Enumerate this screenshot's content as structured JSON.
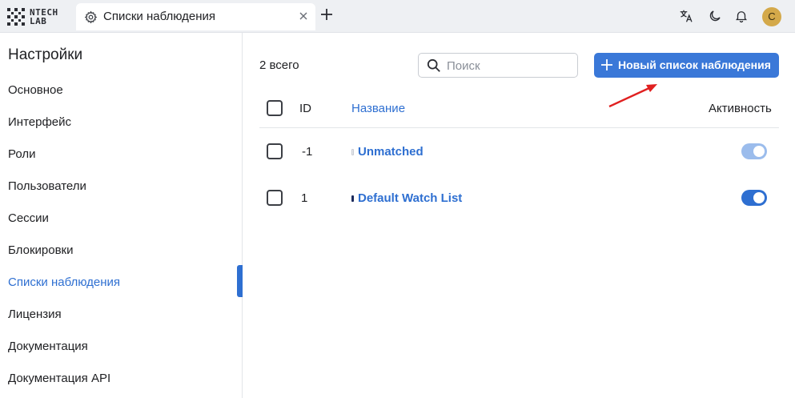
{
  "topbar": {
    "logo_line1": "NTECH",
    "logo_line2": "LAB",
    "tab_label": "Списки наблюдения",
    "tab_icon": "gear-icon",
    "icons": [
      "translate-icon",
      "moon-icon",
      "bell-icon"
    ],
    "avatar_letter": "C",
    "avatar_color": "#d4a94a"
  },
  "sidebar": {
    "title": "Настройки",
    "items": [
      {
        "label": "Основное"
      },
      {
        "label": "Интерфейс"
      },
      {
        "label": "Роли"
      },
      {
        "label": "Пользователи"
      },
      {
        "label": "Сессии"
      },
      {
        "label": "Блокировки"
      },
      {
        "label": "Списки наблюдения"
      },
      {
        "label": "Лицензия"
      },
      {
        "label": "Документация"
      },
      {
        "label": "Документация API"
      }
    ],
    "active_item": "Списки наблюдения",
    "accent_color": "#2e6fd1"
  },
  "main": {
    "count_label": "2 всего",
    "search": {
      "placeholder": "Поиск",
      "value": ""
    },
    "new_button_label": "Новый список наблюдения",
    "table": {
      "columns": {
        "id": "ID",
        "name": "Название",
        "active": "Активность"
      },
      "rows": [
        {
          "id": "-1",
          "name": "Unmatched",
          "color": "#e8eaee",
          "active": true,
          "toggle_style": "dim"
        },
        {
          "id": "1",
          "name": "Default Watch List",
          "color": "#1b2a5c",
          "active": true,
          "toggle_style": "on"
        }
      ]
    }
  }
}
